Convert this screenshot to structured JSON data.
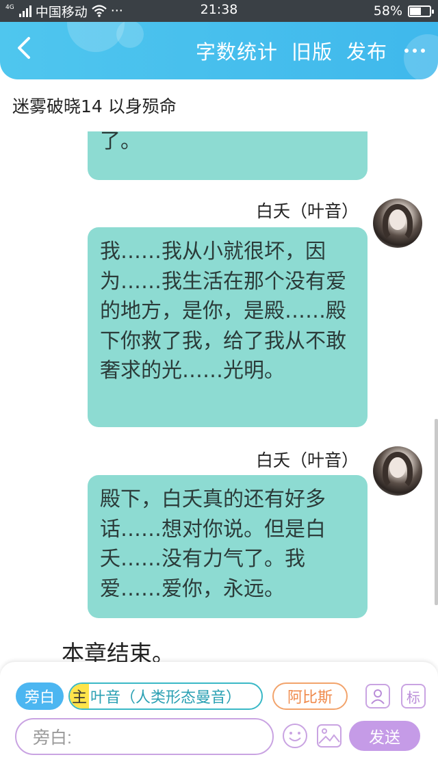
{
  "status_bar": {
    "network_type": "4G",
    "carrier": "中国移动",
    "more": "···",
    "time": "21:38",
    "battery_percent": "58%",
    "battery_level": 0.58
  },
  "header": {
    "back_icon": "chevron-left-icon",
    "word_count_label": "字数统计",
    "old_version_label": "旧版",
    "publish_label": "发布",
    "more_icon": "ellipsis-icon",
    "accent_color": "#44bdec"
  },
  "chapter_title": "迷雾破晓14 以身殒命",
  "messages": [
    {
      "text": "殿下，对不起，我不能陪你了。",
      "partial": true
    },
    {
      "sender": "白夭（叶音）",
      "text": "我……我从小就很坏，因为……我生活在那个没有爱的地方，是你，是殿……殿下你救了我，给了我从不敢奢求的光……光明。"
    },
    {
      "sender": "白夭（叶音）",
      "text": "殿下，白夭真的还有好多话……想对你说。但是白夭……没有力气了。我爱……爱你，永远。"
    }
  ],
  "chapter_end": "本章结束。",
  "composer": {
    "narration_chip": "旁白",
    "main_tag": "主",
    "main_character": "叶音（人类形态曼音）",
    "other_character": "阿比斯",
    "avatar_button_icon": "person-icon",
    "tag_button_label": "标",
    "input_placeholder": "旁白:",
    "emoji_icon": "smile-icon",
    "image_icon": "image-icon",
    "send_label": "发送",
    "bubble_color": "#8ddbd2",
    "send_color": "#c59be7"
  }
}
